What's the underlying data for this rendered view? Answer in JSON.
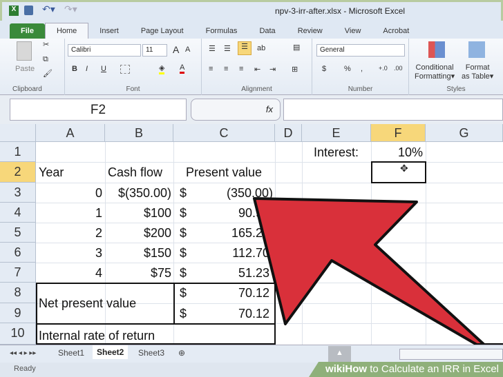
{
  "window": {
    "title": "npv-3-irr-after.xlsx - Microsoft Excel"
  },
  "tabs": [
    "File",
    "Home",
    "Insert",
    "Page Layout",
    "Formulas",
    "Data",
    "Review",
    "View",
    "Acrobat"
  ],
  "ribbon": {
    "paste": "Paste",
    "clipboard": "Clipboard",
    "font_name": "Calibri",
    "font_size": "11",
    "font": "Font",
    "alignment": "Alignment",
    "number_format": "General",
    "number": "Number",
    "dollar": "$",
    "percent": "%",
    "comma": ",",
    "conditional": "Conditional",
    "formatting": "Formatting",
    "format": "Format",
    "as_table": "as Table",
    "styles": "Styles",
    "bold": "B",
    "italic": "I",
    "underline": "U"
  },
  "formula_bar": {
    "name_box": "F2",
    "fx": "fx",
    "value": ""
  },
  "columns": [
    "A",
    "B",
    "C",
    "D",
    "E",
    "F",
    "G"
  ],
  "rows": [
    "1",
    "2",
    "3",
    "4",
    "5",
    "6",
    "7",
    "8",
    "9",
    "10"
  ],
  "cells": {
    "E1": "Interest:",
    "F1": "10%",
    "A2": "Year",
    "B2": "Cash flow",
    "C2": "Present value",
    "A3": "0",
    "B3": "$(350.00)",
    "C3d": "$",
    "C3": "(350.00)",
    "A4": "1",
    "B4": "$100",
    "C4d": "$",
    "C4": "90.91",
    "A5": "2",
    "B5": "$200",
    "C5d": "$",
    "C5": "165.29",
    "A6": "3",
    "B6": "$150",
    "C6d": "$",
    "C6": "112.70",
    "A7": "4",
    "B7": "$75",
    "C7d": "$",
    "C7": "51.23",
    "A8": "Net present value",
    "C8d": "$",
    "C8": "70.12",
    "C9d": "$",
    "C9": "70.12",
    "A10": "Internal rate of return"
  },
  "sheets": [
    "Sheet1",
    "Sheet2",
    "Sheet3"
  ],
  "active_sheet": "Sheet2",
  "status": "Ready",
  "watermark": {
    "brand": "wikiHow",
    "text": "to Calculate an IRR in Excel"
  },
  "colors": {
    "arrow": "#d9303a",
    "file_tab": "#3a8a3a",
    "selected_header": "#f7d77a"
  }
}
